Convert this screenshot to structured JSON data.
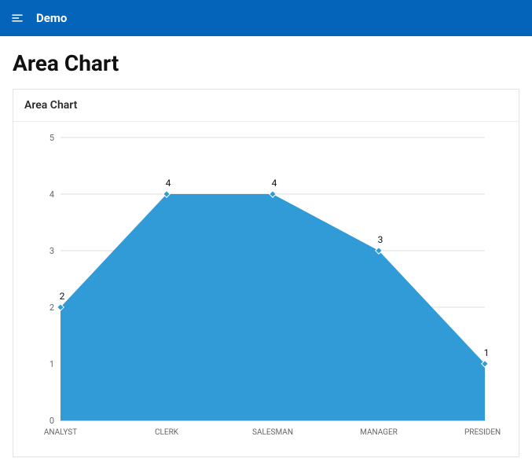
{
  "header": {
    "title": "Demo"
  },
  "page": {
    "title": "Area Chart"
  },
  "card": {
    "title": "Area Chart"
  },
  "chart_data": {
    "type": "area",
    "categories": [
      "ANALYST",
      "CLERK",
      "SALESMAN",
      "MANAGER",
      "PRESIDENT"
    ],
    "values": [
      2,
      4,
      4,
      3,
      1
    ],
    "ylim": [
      0,
      5
    ],
    "yticks": [
      0,
      1,
      2,
      3,
      4,
      5
    ],
    "xlabel": "",
    "ylabel": ""
  }
}
